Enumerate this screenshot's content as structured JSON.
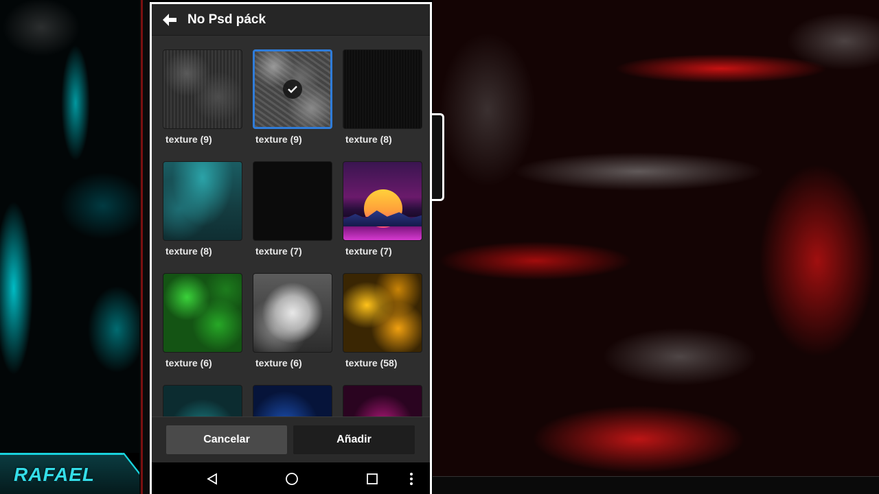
{
  "header": {
    "title": "No Psd páck"
  },
  "tiles": [
    {
      "label": "texture (9)",
      "selected": false
    },
    {
      "label": "texture (9)",
      "selected": true
    },
    {
      "label": "texture (8)",
      "selected": false
    },
    {
      "label": "texture (8)",
      "selected": false
    },
    {
      "label": "texture (7)",
      "selected": false
    },
    {
      "label": "texture (7)",
      "selected": false
    },
    {
      "label": "texture (6)",
      "selected": false
    },
    {
      "label": "texture (6)",
      "selected": false
    },
    {
      "label": "texture (58)",
      "selected": false
    }
  ],
  "buttons": {
    "cancel": "Cancelar",
    "add": "Añadir"
  },
  "watermark": {
    "text": "RAFAEL"
  },
  "colors": {
    "selection": "#2f7cd9",
    "accent_watermark": "#19d3dd"
  }
}
